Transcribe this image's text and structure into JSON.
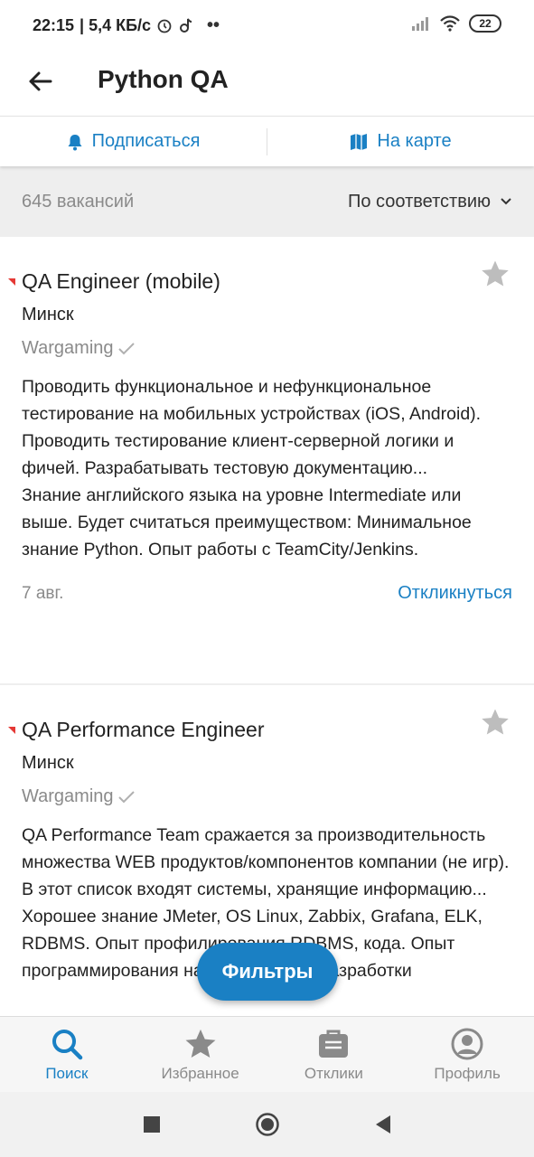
{
  "status_bar": {
    "time": "22:15",
    "speed": "| 5,4 КБ/с",
    "battery": "22",
    "icons": [
      "alarm-icon",
      "tiktok-icon",
      "dots-icon",
      "signal-icon",
      "wifi-icon",
      "battery-icon"
    ]
  },
  "header": {
    "title": "Python QA",
    "back_icon": "arrow-left-icon"
  },
  "actions": {
    "subscribe_label": "Подписаться",
    "map_label": "На карте"
  },
  "sortbar": {
    "count_label": "645 вакансий",
    "sort_label": "По соответствию"
  },
  "vacancies": [
    {
      "title": "QA Engineer (mobile)",
      "city": "Минск",
      "company": "Wargaming",
      "description": "Проводить функциональное и нефункциональное тестирование на мобильных устройствах (iOS, Android). Проводить тестирование клиент-серверной логики и фичей. Разрабатывать тестовую документацию...\nЗнание английского языка на уровне Intermediate или выше. Будет считаться преимуществом: Минимальное знание Python. Опыт работы с TeamCity/Jenkins.",
      "date": "7 авг.",
      "respond_label": "Откликнуться"
    },
    {
      "title": "QA Performance Engineer",
      "city": "Минск",
      "company": "Wargaming",
      "description": "QA Performance Team сражается за производительность множества WEB продуктов/компонентов компании (не игр). В этот список входят системы, хранящие информацию...\nХорошее знание JMeter, OS Linux, Zabbix, Grafana, ELK, RDBMS. Опыт профилирования RDBMS, кода. Опыт программирования на Java, Python, разработки"
    }
  ],
  "fab": {
    "label": "Фильтры"
  },
  "bottom_nav": {
    "items": [
      {
        "label": "Поиск",
        "icon": "search-icon",
        "active": true
      },
      {
        "label": "Избранное",
        "icon": "star-icon"
      },
      {
        "label": "Отклики",
        "icon": "responses-icon"
      },
      {
        "label": "Профиль",
        "icon": "profile-icon"
      }
    ]
  },
  "colors": {
    "accent": "#1a80c4",
    "muted": "#8a8a8a",
    "flag": "#e53935"
  }
}
